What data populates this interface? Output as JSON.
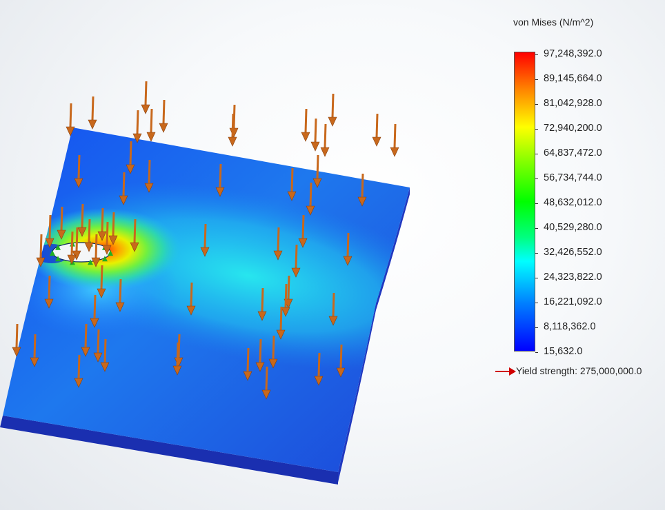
{
  "legend": {
    "title": "von Mises (N/m^2)",
    "ticks": [
      "97,248,392.0",
      "89,145,664.0",
      "81,042,928.0",
      "72,940,200.0",
      "64,837,472.0",
      "56,734,744.0",
      "48,632,012.0",
      "40,529,280.0",
      "32,426,552.0",
      "24,323,822.0",
      "16,221,092.0",
      "8,118,362.0",
      "15,632.0"
    ],
    "yield_label": "Yield strength: 275,000,000.0"
  },
  "colors": {
    "plate_base": "#1c4ee6",
    "plate_edge": "#1a2fb0",
    "arrow": "#c8681c",
    "fixture": "#22b022",
    "yield_arrow": "#d00000"
  },
  "load_arrow_count": 72
}
